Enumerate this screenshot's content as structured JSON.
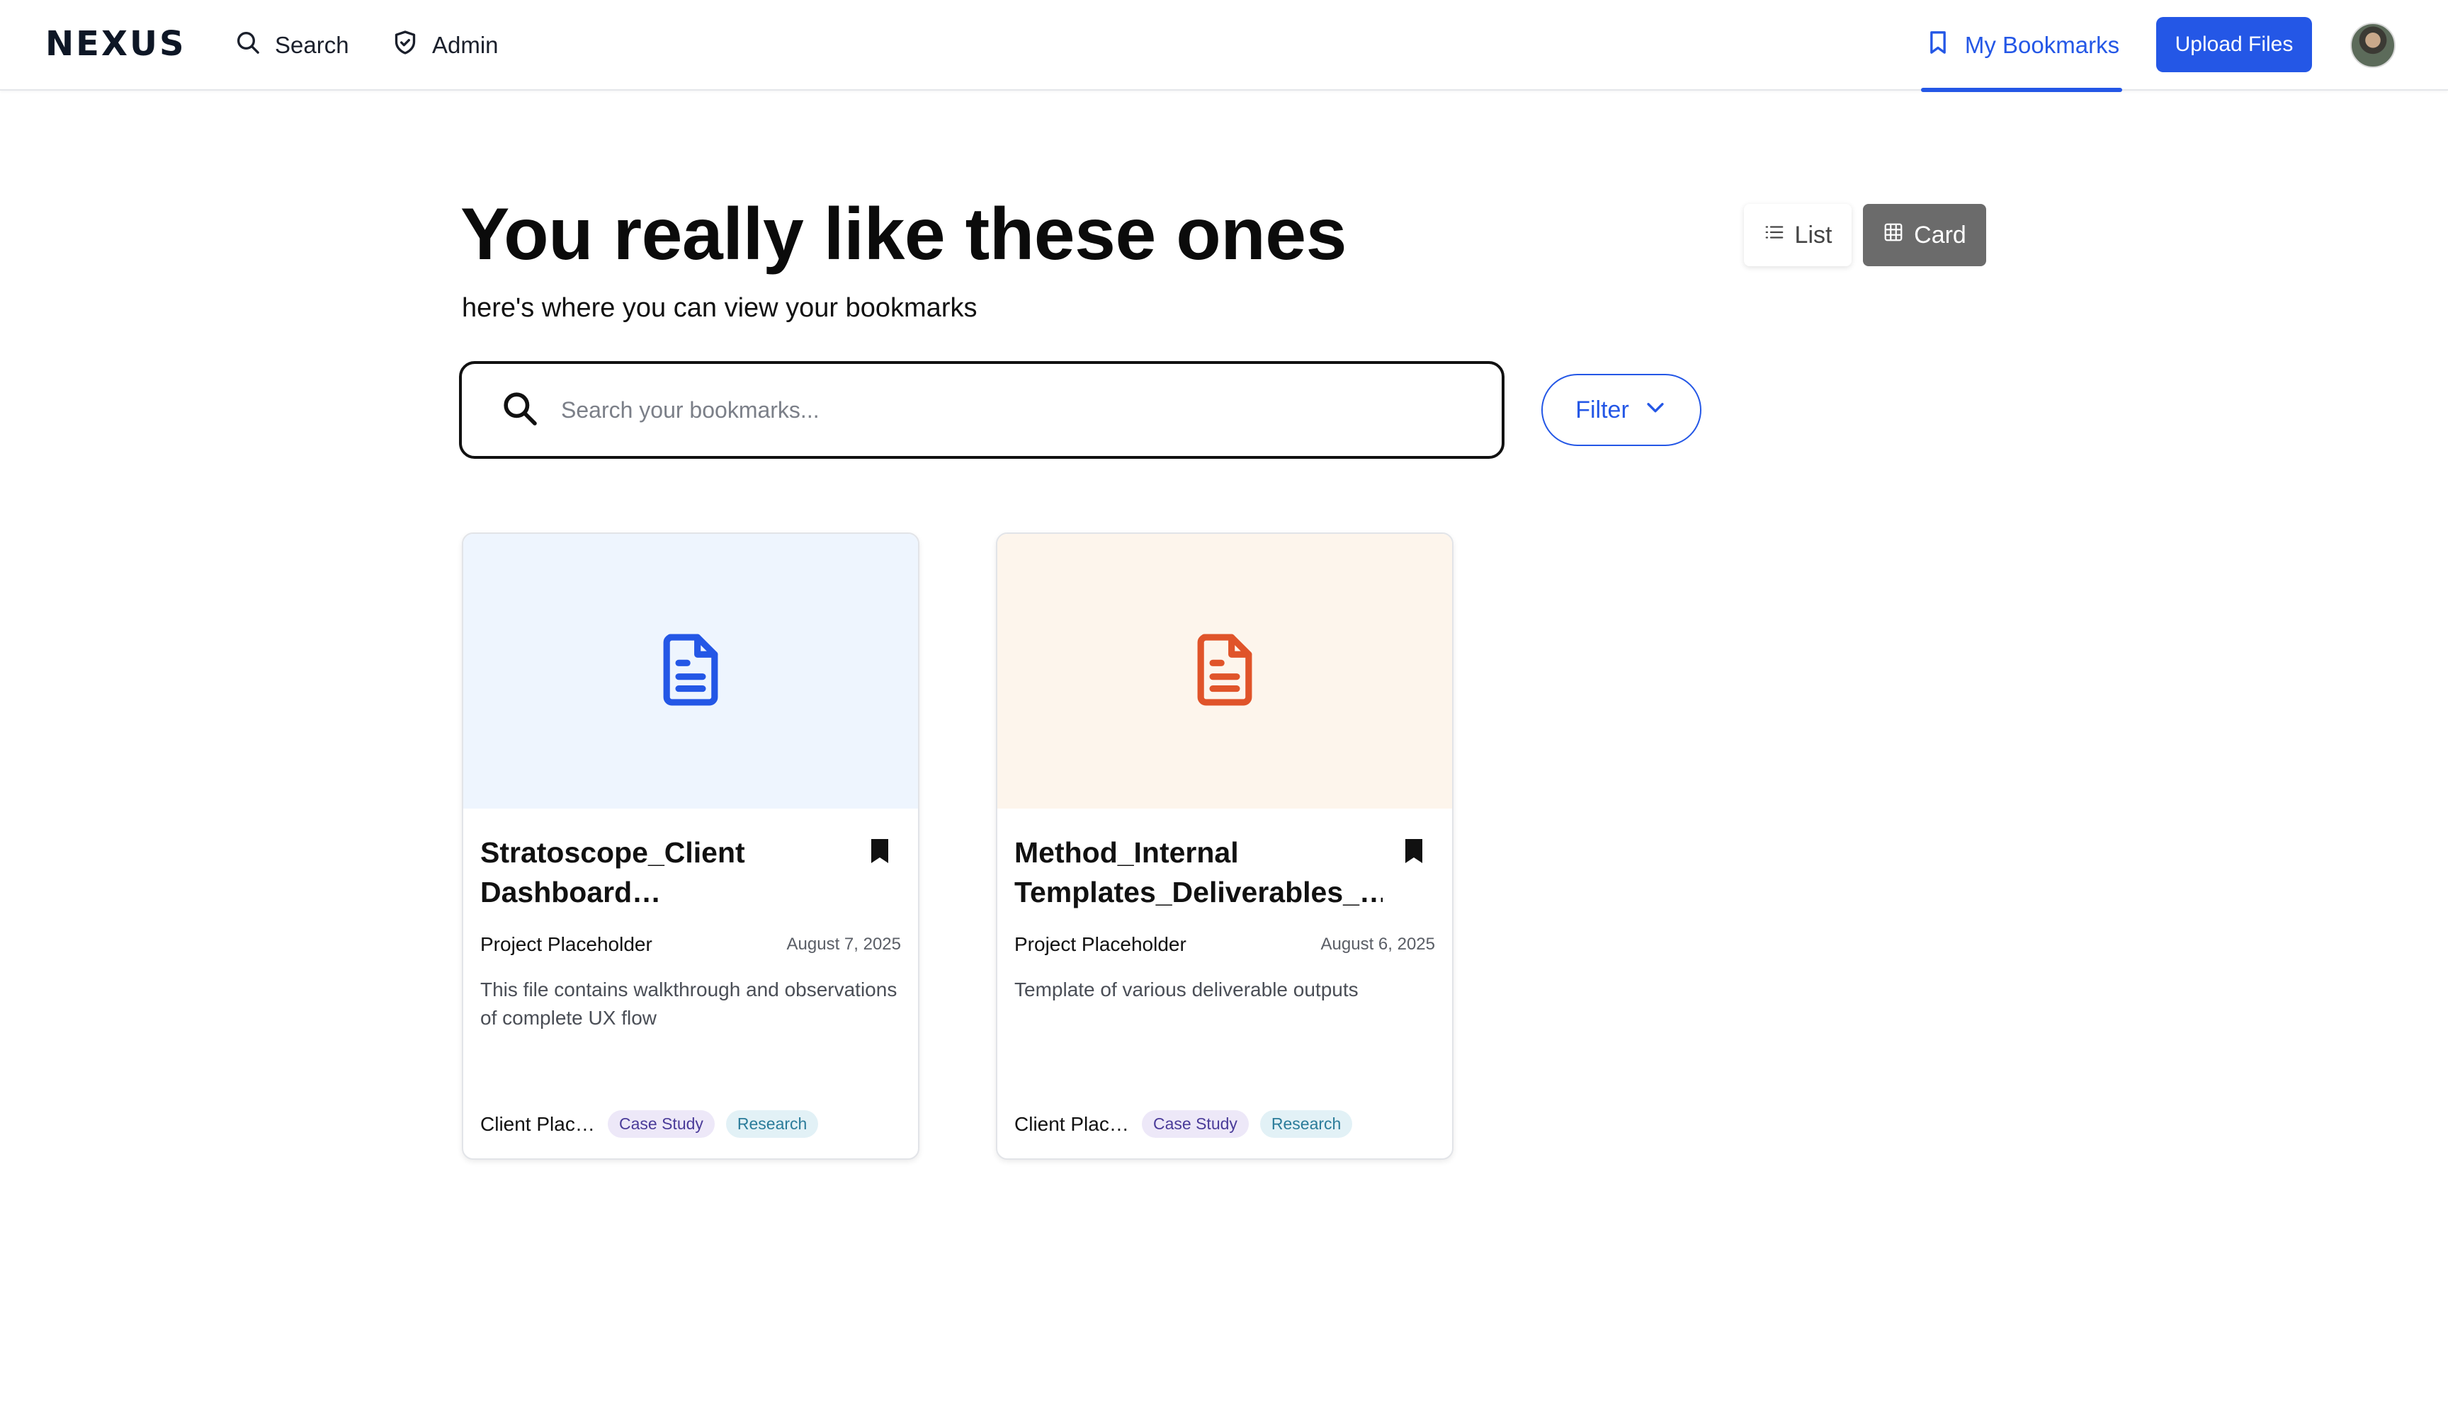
{
  "nav": {
    "logo": "NEXUS",
    "search_label": "Search",
    "admin_label": "Admin",
    "bookmarks_label": "My Bookmarks",
    "upload_label": "Upload Files",
    "accent_color": "#2457e6"
  },
  "header": {
    "title": "You really like these ones",
    "subtitle": "here's where you can view your bookmarks"
  },
  "view_toggle": {
    "list_label": "List",
    "card_label": "Card",
    "selected": "Card"
  },
  "search": {
    "placeholder": "Search your bookmarks...",
    "value": ""
  },
  "filter": {
    "label": "Filter"
  },
  "cards": [
    {
      "title": "Stratoscope_Client Dashboard…",
      "project": "Project Placeholder",
      "date": "August 7, 2025",
      "description": "This file contains walkthrough and observations of complete UX flow",
      "client": "Client Plac…",
      "tags": [
        "Case Study",
        "Research"
      ],
      "icon": "document-icon",
      "icon_color": "#2457e6",
      "thumb_color": "#eef5fe",
      "bookmarked": true
    },
    {
      "title": "Method_Internal Templates_Deliverables_…",
      "project": "Project Placeholder",
      "date": "August 6, 2025",
      "description": "Template of various deliverable outputs",
      "client": "Client Plac…",
      "tags": [
        "Case Study",
        "Research"
      ],
      "icon": "document-icon",
      "icon_color": "#e0542a",
      "thumb_color": "#fdf5ec",
      "bookmarked": true
    }
  ]
}
